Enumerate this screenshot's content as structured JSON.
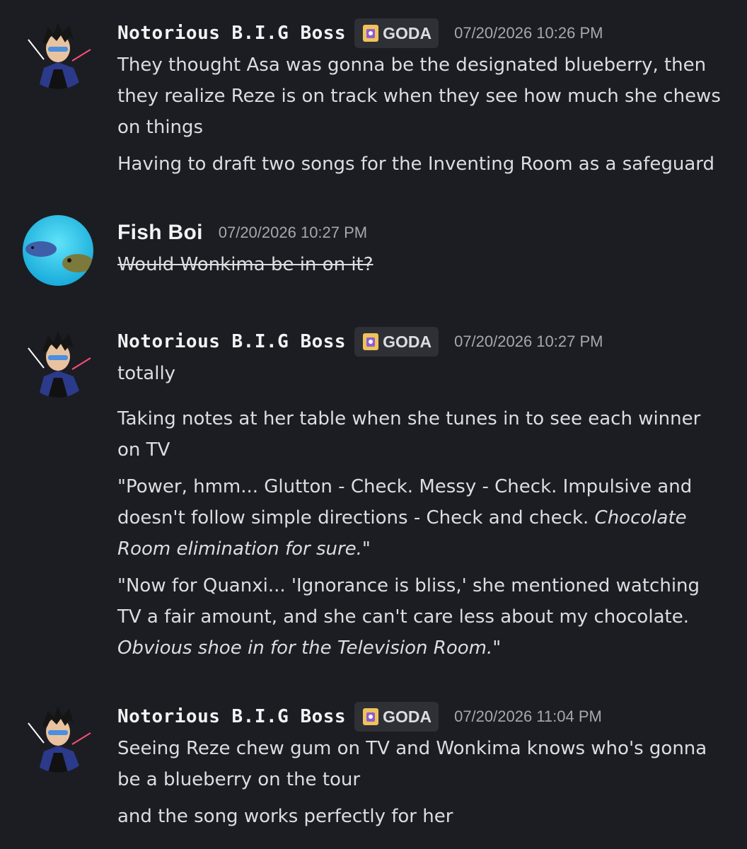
{
  "messages": [
    {
      "username": "Notorious B.I.G Boss",
      "tag": "GODA",
      "timestamp": "07/20/2026 10:26 PM",
      "lines": [
        "They thought Asa was gonna be the designated blueberry, then",
        "they realize Reze is on track when they see how much she chews",
        "on things",
        "Having to draft two songs for the Inventing Room as a safeguard"
      ]
    },
    {
      "username": "Fish Boi",
      "timestamp": "07/20/2026 10:27 PM",
      "lines": [
        "Would Wonkima be in on it?"
      ]
    },
    {
      "username": "Notorious B.I.G Boss",
      "tag": "GODA",
      "timestamp": "07/20/2026 10:27 PM",
      "lines": [
        "totally",
        "Taking notes at her table when she tunes in to see each winner",
        "on TV",
        "\"Power, hmm... Glutton - Check. Messy - Check. Impulsive and",
        "doesn't follow simple directions - Check and check. ",
        "Chocolate",
        "Room elimination for sure.\"",
        "\"Now for Quanxi... 'Ignorance is bliss,' she mentioned watching",
        "TV a fair amount, and she can't care less about my chocolate.",
        "Obvious shoe in for the Television Room.\""
      ]
    },
    {
      "username": "Notorious B.I.G Boss",
      "tag": "GODA",
      "timestamp": "07/20/2026 11:04 PM",
      "lines": [
        "Seeing Reze chew gum on TV and Wonkima knows who's gonna",
        "be a blueberry on the tour",
        "and the song works perfectly for her"
      ]
    }
  ],
  "colors": {
    "background": "#1c1d22",
    "text": "#dbdee1",
    "timestamp": "#a4a8b0",
    "tag_bg": "#2e3036"
  }
}
